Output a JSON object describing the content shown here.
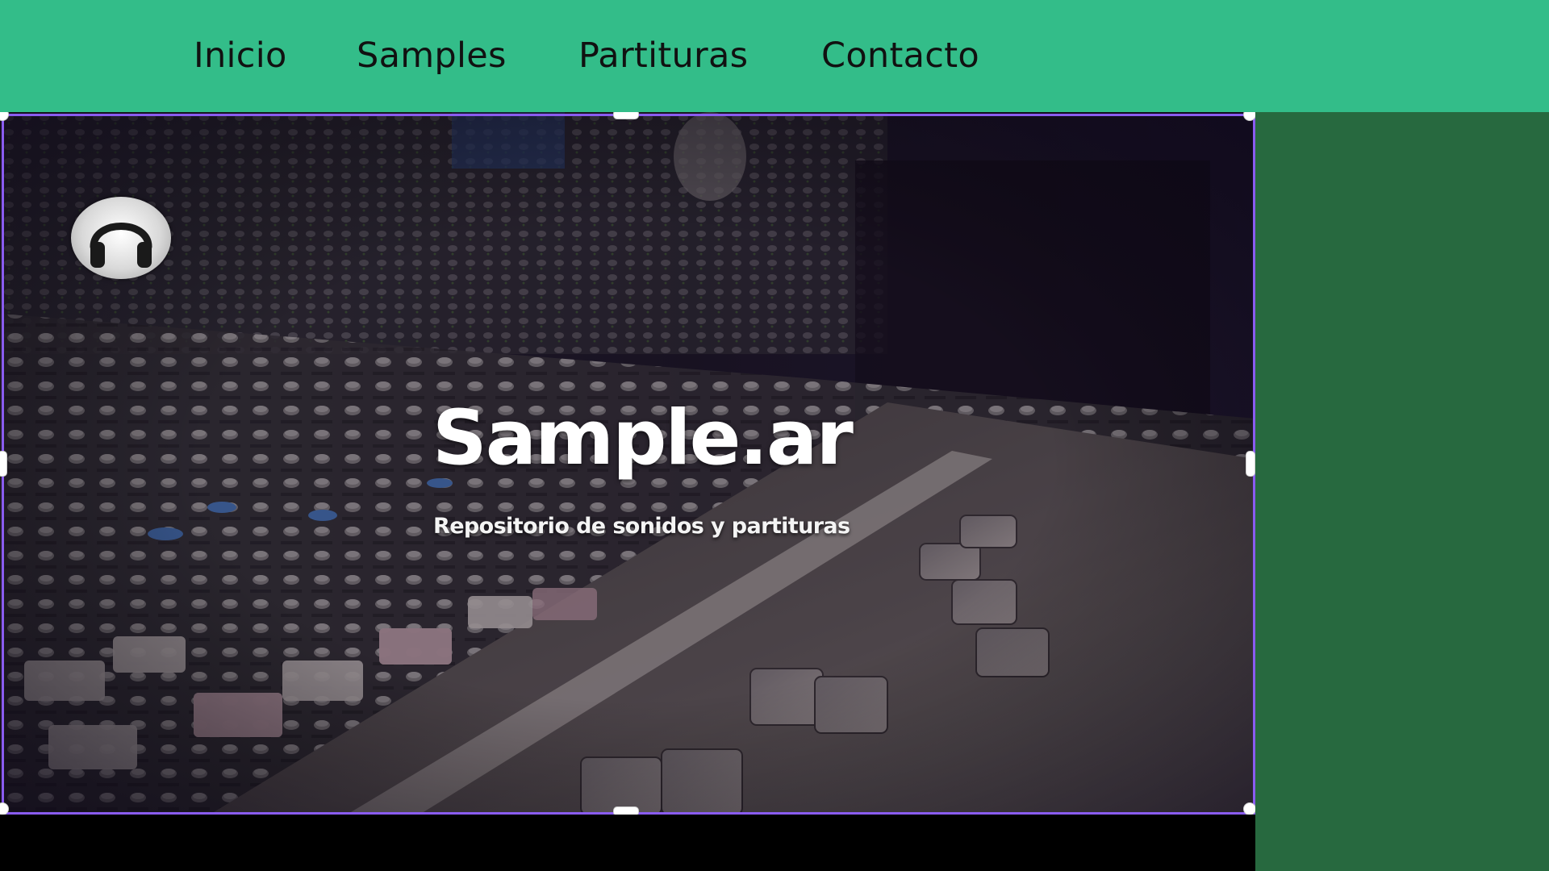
{
  "nav": {
    "items": [
      {
        "label": "Inicio"
      },
      {
        "label": "Samples"
      },
      {
        "label": "Partituras"
      },
      {
        "label": "Contacto"
      }
    ]
  },
  "hero": {
    "title": "Sample.ar",
    "subtitle": "Repositorio de sonidos y partituras",
    "logo_icon": "headphones-icon",
    "background_image": "mixing-console-photo"
  },
  "colors": {
    "navbar": "#33bd89",
    "side_panel": "#27693f",
    "selection_border": "#8a5cf0",
    "page_background": "#000000"
  }
}
